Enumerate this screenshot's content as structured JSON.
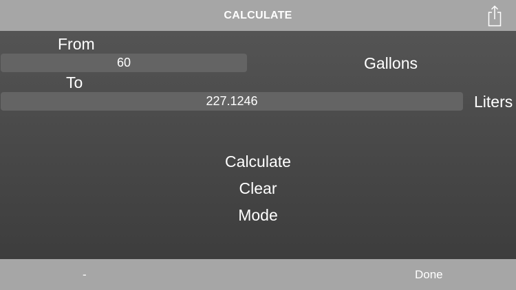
{
  "nav": {
    "title": "CALCULATE",
    "share_icon": "share-icon"
  },
  "from": {
    "label": "From",
    "value": "60",
    "unit": "Gallons"
  },
  "to": {
    "label": "To",
    "value": "227.1246",
    "unit": "Liters"
  },
  "actions": {
    "calculate": "Calculate",
    "clear": "Clear",
    "mode": "Mode"
  },
  "toolbar": {
    "minus_label": "-",
    "done_label": "Done"
  },
  "colors": {
    "bar": "#a6a6a6",
    "field": "#646464",
    "text": "#ffffff"
  }
}
